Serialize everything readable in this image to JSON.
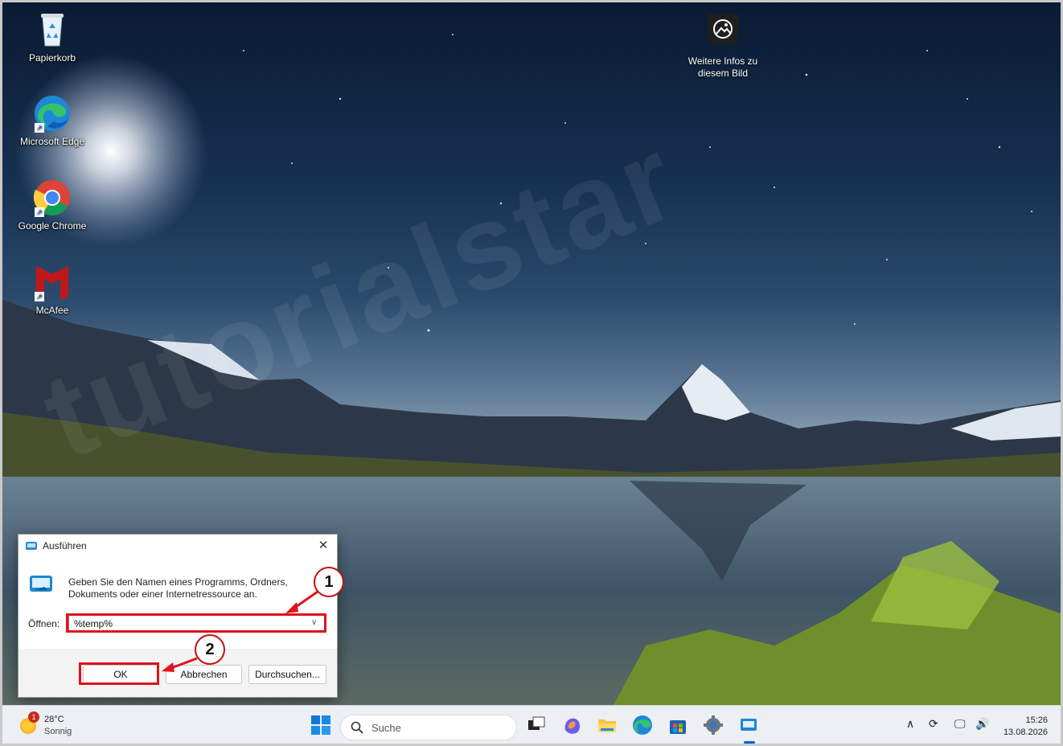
{
  "desktop": {
    "icons": [
      {
        "label": "Papierkorb"
      },
      {
        "label": "Microsoft Edge"
      },
      {
        "label": "Google Chrome"
      },
      {
        "label": "McAfee"
      }
    ],
    "info_label": "Weitere Infos zu diesem Bild",
    "watermark": "tutorialstar"
  },
  "run_dialog": {
    "title": "Ausführen",
    "description": "Geben Sie den Namen eines Programms, Ordners, Dokuments oder einer Internetressource an.",
    "open_label": "Öffnen:",
    "open_value": "%temp%",
    "ok_label": "OK",
    "cancel_label": "Abbrechen",
    "browse_label": "Durchsuchen..."
  },
  "annotations": {
    "step1": "1",
    "step2": "2",
    "highlight_color": "#e0121b"
  },
  "taskbar": {
    "weather_temp": "28°C",
    "weather_condition": "Sonnig",
    "weather_badge": "1",
    "search_placeholder": "Suche",
    "time": "15:26",
    "date": "13.08.2026"
  }
}
